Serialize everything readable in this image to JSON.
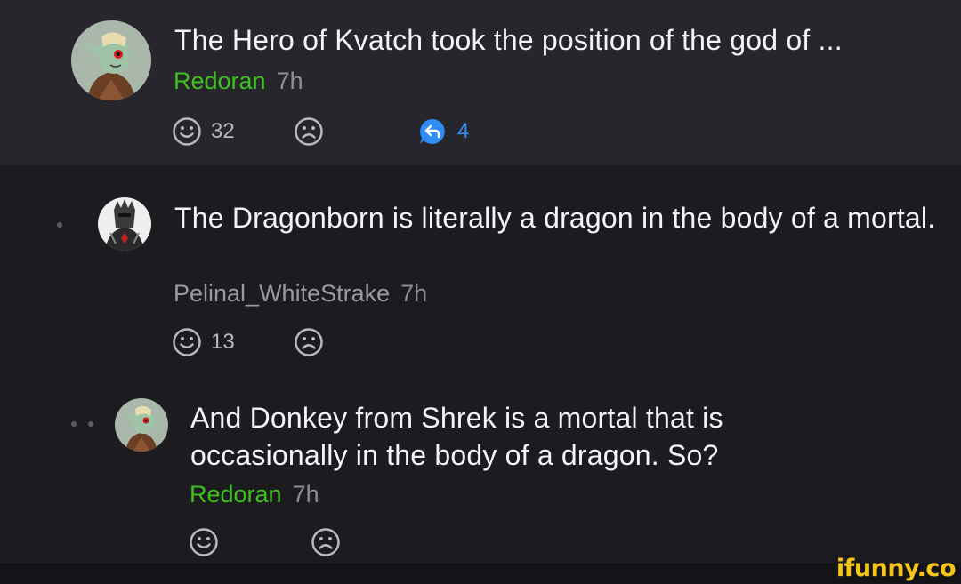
{
  "comments": [
    {
      "text": "The Hero of Kvatch took the position of the god of ...",
      "author": "Redoran",
      "time": "7h",
      "smile_count": "32",
      "frown_count": "",
      "reply_count": "4"
    },
    {
      "text": "The Dragonborn is literally a dragon in the body of a mortal.",
      "author": "Pelinal_WhiteStrake",
      "time": "7h",
      "smile_count": "13",
      "frown_count": ""
    },
    {
      "text": "And Donkey from Shrek is a mortal that is occasionally in the body of a dragon. So?",
      "author": "Redoran",
      "time": "7h",
      "smile_count": "",
      "frown_count": ""
    }
  ],
  "watermark": "ifunny.co",
  "colors": {
    "background": "#1b1b20",
    "highlight_background": "#26262c",
    "author_green": "#3dc11e",
    "reply_blue": "#2f8cf5",
    "watermark_yellow": "#f5c518"
  }
}
